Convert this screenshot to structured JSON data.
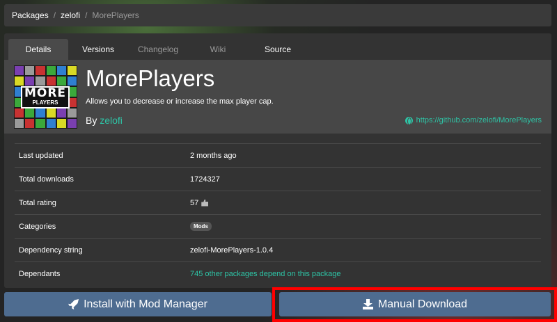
{
  "breadcrumb": {
    "items": [
      "Packages",
      "zelofi",
      "MorePlayers"
    ],
    "separator": "/"
  },
  "tabs": [
    {
      "label": "Details",
      "active": true
    },
    {
      "label": "Versions",
      "active": false
    },
    {
      "label": "Changelog",
      "active": false,
      "muted": true
    },
    {
      "label": "Wiki",
      "active": false,
      "muted": true
    },
    {
      "label": "Source",
      "active": false
    }
  ],
  "package": {
    "name": "MorePlayers",
    "description": "Allows you to decrease or increase the max player cap.",
    "by_label": "By",
    "author": "zelofi",
    "repo_url": "https://github.com/zelofi/MorePlayers",
    "logo_text_big": "MORE",
    "logo_text_small": "PLAYERS"
  },
  "details": {
    "last_updated": {
      "label": "Last updated",
      "value": "2 months ago"
    },
    "total_downloads": {
      "label": "Total downloads",
      "value": "1724327"
    },
    "total_rating": {
      "label": "Total rating",
      "value": "57"
    },
    "categories": {
      "label": "Categories",
      "value": "Mods"
    },
    "dependency_string": {
      "label": "Dependency string",
      "value": "zelofi-MorePlayers-1.0.4"
    },
    "dependants": {
      "label": "Dependants",
      "value": "745 other packages depend on this package"
    }
  },
  "actions": {
    "install_label": "Install with Mod Manager",
    "download_label": "Manual Download"
  },
  "colors": {
    "accent_green": "#2ec4a6",
    "button_blue": "#4e6c90",
    "highlight_red": "#ff0000"
  }
}
